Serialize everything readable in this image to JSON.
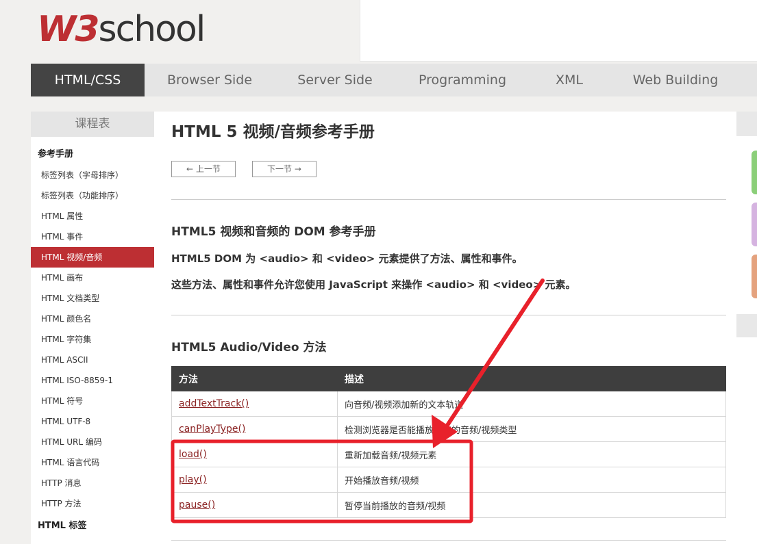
{
  "logo": {
    "w3": "W3",
    "school": "school"
  },
  "topnav": [
    {
      "label": "HTML/CSS",
      "active": true,
      "width": 166
    },
    {
      "label": "Browser Side",
      "width": 190
    },
    {
      "label": "Server Side",
      "width": 176
    },
    {
      "label": "Programming",
      "width": 196
    },
    {
      "label": "XML",
      "width": 116
    },
    {
      "label": "Web Building",
      "width": 194
    }
  ],
  "sidebar": {
    "title": "课程表",
    "group1": "参考手册",
    "items": [
      "标签列表（字母排序）",
      "标签列表（功能排序）",
      "HTML 属性",
      "HTML 事件",
      "HTML 视频/音频",
      "HTML 画布",
      "HTML 文档类型",
      "HTML 颜色名",
      "HTML 字符集",
      "HTML ASCII",
      "HTML ISO-8859-1",
      "HTML 符号",
      "HTML UTF-8",
      "HTML URL 编码",
      "HTML 语言代码",
      "HTTP 消息",
      "HTTP 方法"
    ],
    "active_index": 4,
    "group2": "HTML 标签"
  },
  "main": {
    "title": "HTML 5 视频/音频参考手册",
    "prev": "上一节",
    "next": "下一节",
    "section1_title": "HTML5 视频和音频的 DOM 参考手册",
    "para1": "HTML5 DOM 为 <audio> 和 <video> 元素提供了方法、属性和事件。",
    "para2": "这些方法、属性和事件允许您使用 JavaScript 来操作 <audio> 和 <video> 元素。",
    "section2_title": "HTML5 Audio/Video 方法",
    "table": {
      "headers": [
        "方法",
        "描述"
      ],
      "rows": [
        [
          "addTextTrack()",
          "向音频/视频添加新的文本轨道"
        ],
        [
          "canPlayType()",
          "检测浏览器是否能播放指定的音频/视频类型"
        ],
        [
          "load()",
          "重新加载音频/视频元素"
        ],
        [
          "play()",
          "开始播放音频/视频"
        ],
        [
          "pause()",
          "暂停当前播放的音频/视频"
        ]
      ]
    }
  },
  "colors": {
    "accent": "#bd2f33",
    "annotation": "#e8212b",
    "rail_green": "#8bcf79",
    "rail_purple": "#d5b3e0",
    "rail_orange": "#e4a27e"
  },
  "icons": {
    "prev": "arrow-left-icon",
    "next": "arrow-right-icon"
  }
}
